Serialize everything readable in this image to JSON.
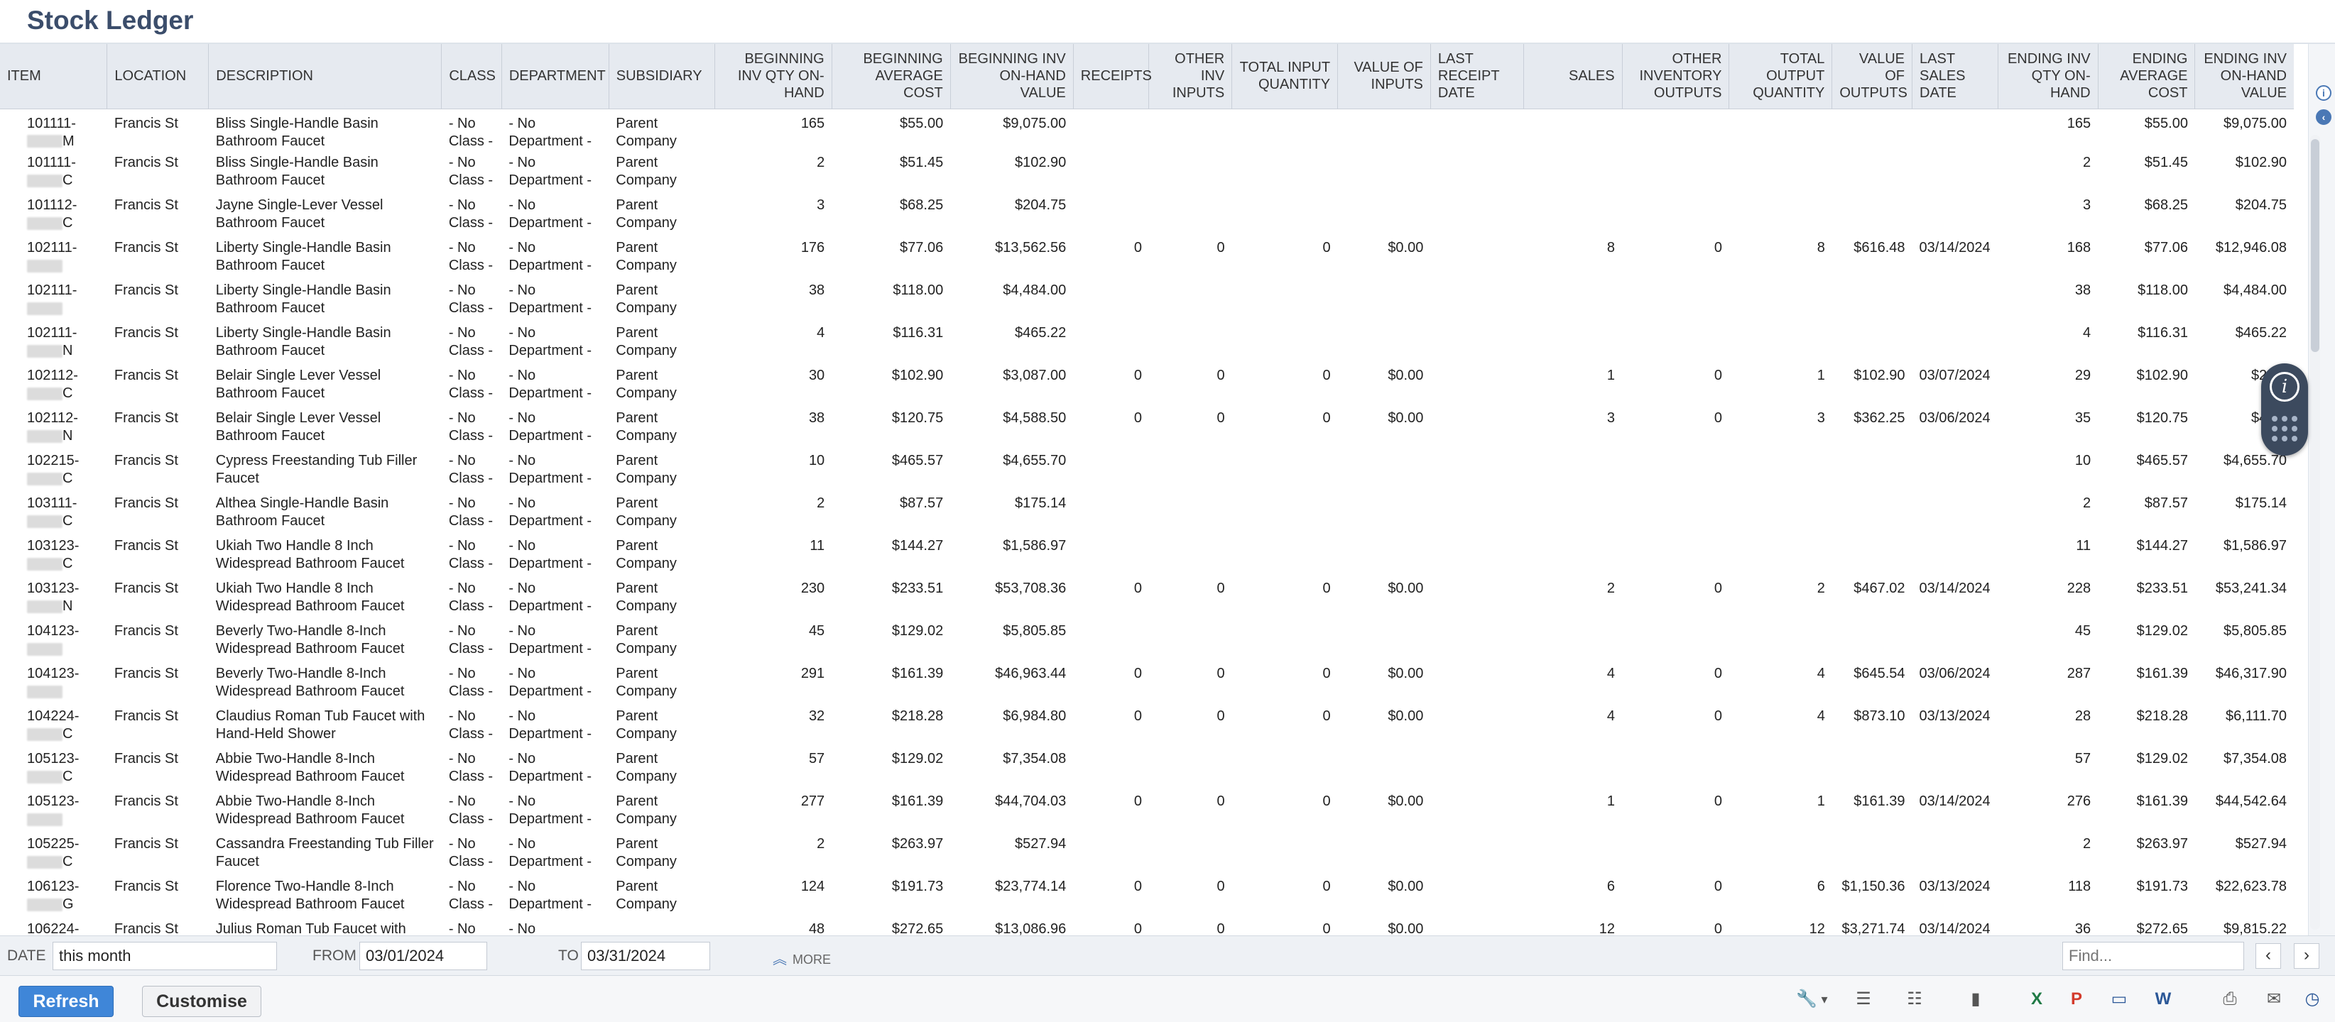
{
  "page": {
    "title": "Stock Ledger"
  },
  "table": {
    "headers": {
      "item": "ITEM",
      "location": "LOCATION",
      "description": "DESCRIPTION",
      "class": "CLASS",
      "department": "DEPARTMENT",
      "subsidiary": "SUBSIDIARY",
      "beg_qty": "BEGINNING INV QTY ON-HAND",
      "beg_avg": "BEGINNING AVERAGE COST",
      "beg_val": "BEGINNING INV ON-HAND VALUE",
      "receipts": "RECEIPTS",
      "other_inputs": "OTHER INV INPUTS",
      "total_input": "TOTAL INPUT QUANTITY",
      "value_inputs": "VALUE OF INPUTS",
      "last_receipt": "LAST RECEIPT DATE",
      "sales": "SALES",
      "other_outputs": "OTHER INVENTORY OUTPUTS",
      "total_output": "TOTAL OUTPUT QUANTITY",
      "value_outputs": "VALUE OF OUTPUTS",
      "last_sales": "LAST SALES DATE",
      "end_qty": "ENDING INV QTY ON-HAND",
      "end_avg": "ENDING AVERAGE COST",
      "end_val": "ENDING INV ON-HAND VALUE"
    },
    "rows": [
      {
        "item": "101111-",
        "item2": "M",
        "location": "Francis St",
        "description": "Bliss Single-Handle Basin Bathroom Faucet",
        "class": "- No Class -",
        "department": "- No Department -",
        "subsidiary": "Parent Company",
        "beg_qty": "165",
        "beg_avg": "$55.00",
        "beg_val": "$9,075.00",
        "receipts": "",
        "other_inputs": "",
        "total_input": "",
        "value_inputs": "",
        "last_receipt": "",
        "sales": "",
        "other_outputs": "",
        "total_output": "",
        "value_outputs": "",
        "last_sales": "",
        "end_qty": "165",
        "end_avg": "$55.00",
        "end_val": "$9,075.00"
      },
      {
        "item": "101111-",
        "item2": "C",
        "location": "Francis St",
        "description": "Bliss Single-Handle Basin Bathroom Faucet",
        "class": "- No Class -",
        "department": "- No Department -",
        "subsidiary": "Parent Company",
        "beg_qty": "2",
        "beg_avg": "$51.45",
        "beg_val": "$102.90",
        "receipts": "",
        "other_inputs": "",
        "total_input": "",
        "value_inputs": "",
        "last_receipt": "",
        "sales": "",
        "other_outputs": "",
        "total_output": "",
        "value_outputs": "",
        "last_sales": "",
        "end_qty": "2",
        "end_avg": "$51.45",
        "end_val": "$102.90"
      },
      {
        "item": "101112-",
        "item2": "C",
        "location": "Francis St",
        "description": "Jayne Single-Lever Vessel Bathroom Faucet",
        "class": "- No Class -",
        "department": "- No Department -",
        "subsidiary": "Parent Company",
        "beg_qty": "3",
        "beg_avg": "$68.25",
        "beg_val": "$204.75",
        "receipts": "",
        "other_inputs": "",
        "total_input": "",
        "value_inputs": "",
        "last_receipt": "",
        "sales": "",
        "other_outputs": "",
        "total_output": "",
        "value_outputs": "",
        "last_sales": "",
        "end_qty": "3",
        "end_avg": "$68.25",
        "end_val": "$204.75"
      },
      {
        "item": "102111-",
        "item2": "",
        "location": "Francis St",
        "description": "Liberty Single-Handle Basin Bathroom Faucet",
        "class": "- No Class -",
        "department": "- No Department -",
        "subsidiary": "Parent Company",
        "beg_qty": "176",
        "beg_avg": "$77.06",
        "beg_val": "$13,562.56",
        "receipts": "0",
        "other_inputs": "0",
        "total_input": "0",
        "value_inputs": "$0.00",
        "last_receipt": "",
        "sales": "8",
        "other_outputs": "0",
        "total_output": "8",
        "value_outputs": "$616.48",
        "last_sales": "03/14/2024",
        "end_qty": "168",
        "end_avg": "$77.06",
        "end_val": "$12,946.08"
      },
      {
        "item": "102111-",
        "item2": "",
        "location": "Francis St",
        "description": "Liberty Single-Handle Basin Bathroom Faucet",
        "class": "- No Class -",
        "department": "- No Department -",
        "subsidiary": "Parent Company",
        "beg_qty": "38",
        "beg_avg": "$118.00",
        "beg_val": "$4,484.00",
        "receipts": "",
        "other_inputs": "",
        "total_input": "",
        "value_inputs": "",
        "last_receipt": "",
        "sales": "",
        "other_outputs": "",
        "total_output": "",
        "value_outputs": "",
        "last_sales": "",
        "end_qty": "38",
        "end_avg": "$118.00",
        "end_val": "$4,484.00"
      },
      {
        "item": "102111-",
        "item2": "N",
        "location": "Francis St",
        "description": "Liberty Single-Handle Basin Bathroom Faucet",
        "class": "- No Class -",
        "department": "- No Department -",
        "subsidiary": "Parent Company",
        "beg_qty": "4",
        "beg_avg": "$116.31",
        "beg_val": "$465.22",
        "receipts": "",
        "other_inputs": "",
        "total_input": "",
        "value_inputs": "",
        "last_receipt": "",
        "sales": "",
        "other_outputs": "",
        "total_output": "",
        "value_outputs": "",
        "last_sales": "",
        "end_qty": "4",
        "end_avg": "$116.31",
        "end_val": "$465.22"
      },
      {
        "item": "102112-",
        "item2": "C",
        "location": "Francis St",
        "description": "Belair Single Lever Vessel Bathroom Faucet",
        "class": "- No Class -",
        "department": "- No Department -",
        "subsidiary": "Parent Company",
        "beg_qty": "30",
        "beg_avg": "$102.90",
        "beg_val": "$3,087.00",
        "receipts": "0",
        "other_inputs": "0",
        "total_input": "0",
        "value_inputs": "$0.00",
        "last_receipt": "",
        "sales": "1",
        "other_outputs": "0",
        "total_output": "1",
        "value_outputs": "$102.90",
        "last_sales": "03/07/2024",
        "end_qty": "29",
        "end_avg": "$102.90",
        "end_val": "$2,98"
      },
      {
        "item": "102112-",
        "item2": "N",
        "location": "Francis St",
        "description": "Belair Single Lever Vessel Bathroom Faucet",
        "class": "- No Class -",
        "department": "- No Department -",
        "subsidiary": "Parent Company",
        "beg_qty": "38",
        "beg_avg": "$120.75",
        "beg_val": "$4,588.50",
        "receipts": "0",
        "other_inputs": "0",
        "total_input": "0",
        "value_inputs": "$0.00",
        "last_receipt": "",
        "sales": "3",
        "other_outputs": "0",
        "total_output": "3",
        "value_outputs": "$362.25",
        "last_sales": "03/06/2024",
        "end_qty": "35",
        "end_avg": "$120.75",
        "end_val": "$4,22"
      },
      {
        "item": "102215-",
        "item2": "C",
        "location": "Francis St",
        "description": "Cypress Freestanding Tub Filler Faucet",
        "class": "- No Class -",
        "department": "- No Department -",
        "subsidiary": "Parent Company",
        "beg_qty": "10",
        "beg_avg": "$465.57",
        "beg_val": "$4,655.70",
        "receipts": "",
        "other_inputs": "",
        "total_input": "",
        "value_inputs": "",
        "last_receipt": "",
        "sales": "",
        "other_outputs": "",
        "total_output": "",
        "value_outputs": "",
        "last_sales": "",
        "end_qty": "10",
        "end_avg": "$465.57",
        "end_val": "$4,655.70"
      },
      {
        "item": "103111-",
        "item2": "C",
        "location": "Francis St",
        "description": "Althea Single-Handle Basin Bathroom Faucet",
        "class": "- No Class -",
        "department": "- No Department -",
        "subsidiary": "Parent Company",
        "beg_qty": "2",
        "beg_avg": "$87.57",
        "beg_val": "$175.14",
        "receipts": "",
        "other_inputs": "",
        "total_input": "",
        "value_inputs": "",
        "last_receipt": "",
        "sales": "",
        "other_outputs": "",
        "total_output": "",
        "value_outputs": "",
        "last_sales": "",
        "end_qty": "2",
        "end_avg": "$87.57",
        "end_val": "$175.14"
      },
      {
        "item": "103123-",
        "item2": "C",
        "location": "Francis St",
        "description": "Ukiah Two Handle 8 Inch Widespread Bathroom Faucet",
        "class": "- No Class -",
        "department": "- No Department -",
        "subsidiary": "Parent Company",
        "beg_qty": "11",
        "beg_avg": "$144.27",
        "beg_val": "$1,586.97",
        "receipts": "",
        "other_inputs": "",
        "total_input": "",
        "value_inputs": "",
        "last_receipt": "",
        "sales": "",
        "other_outputs": "",
        "total_output": "",
        "value_outputs": "",
        "last_sales": "",
        "end_qty": "11",
        "end_avg": "$144.27",
        "end_val": "$1,586.97"
      },
      {
        "item": "103123-",
        "item2": "N",
        "location": "Francis St",
        "description": "Ukiah Two Handle 8 Inch Widespread Bathroom Faucet",
        "class": "- No Class -",
        "department": "- No Department -",
        "subsidiary": "Parent Company",
        "beg_qty": "230",
        "beg_avg": "$233.51",
        "beg_val": "$53,708.36",
        "receipts": "0",
        "other_inputs": "0",
        "total_input": "0",
        "value_inputs": "$0.00",
        "last_receipt": "",
        "sales": "2",
        "other_outputs": "0",
        "total_output": "2",
        "value_outputs": "$467.02",
        "last_sales": "03/14/2024",
        "end_qty": "228",
        "end_avg": "$233.51",
        "end_val": "$53,241.34"
      },
      {
        "item": "104123-",
        "item2": "",
        "location": "Francis St",
        "description": "Beverly Two-Handle 8-Inch Widespread Bathroom Faucet",
        "class": "- No Class -",
        "department": "- No Department -",
        "subsidiary": "Parent Company",
        "beg_qty": "45",
        "beg_avg": "$129.02",
        "beg_val": "$5,805.85",
        "receipts": "",
        "other_inputs": "",
        "total_input": "",
        "value_inputs": "",
        "last_receipt": "",
        "sales": "",
        "other_outputs": "",
        "total_output": "",
        "value_outputs": "",
        "last_sales": "",
        "end_qty": "45",
        "end_avg": "$129.02",
        "end_val": "$5,805.85"
      },
      {
        "item": "104123-",
        "item2": "",
        "location": "Francis St",
        "description": "Beverly Two-Handle 8-Inch Widespread Bathroom Faucet",
        "class": "- No Class -",
        "department": "- No Department -",
        "subsidiary": "Parent Company",
        "beg_qty": "291",
        "beg_avg": "$161.39",
        "beg_val": "$46,963.44",
        "receipts": "0",
        "other_inputs": "0",
        "total_input": "0",
        "value_inputs": "$0.00",
        "last_receipt": "",
        "sales": "4",
        "other_outputs": "0",
        "total_output": "4",
        "value_outputs": "$645.54",
        "last_sales": "03/06/2024",
        "end_qty": "287",
        "end_avg": "$161.39",
        "end_val": "$46,317.90"
      },
      {
        "item": "104224-",
        "item2": "C",
        "location": "Francis St",
        "description": "Claudius Roman Tub Faucet with Hand-Held Shower",
        "class": "- No Class -",
        "department": "- No Department -",
        "subsidiary": "Parent Company",
        "beg_qty": "32",
        "beg_avg": "$218.28",
        "beg_val": "$6,984.80",
        "receipts": "0",
        "other_inputs": "0",
        "total_input": "0",
        "value_inputs": "$0.00",
        "last_receipt": "",
        "sales": "4",
        "other_outputs": "0",
        "total_output": "4",
        "value_outputs": "$873.10",
        "last_sales": "03/13/2024",
        "end_qty": "28",
        "end_avg": "$218.28",
        "end_val": "$6,111.70"
      },
      {
        "item": "105123-",
        "item2": "C",
        "location": "Francis St",
        "description": "Abbie Two-Handle 8-Inch Widespread Bathroom Faucet",
        "class": "- No Class -",
        "department": "- No Department -",
        "subsidiary": "Parent Company",
        "beg_qty": "57",
        "beg_avg": "$129.02",
        "beg_val": "$7,354.08",
        "receipts": "",
        "other_inputs": "",
        "total_input": "",
        "value_inputs": "",
        "last_receipt": "",
        "sales": "",
        "other_outputs": "",
        "total_output": "",
        "value_outputs": "",
        "last_sales": "",
        "end_qty": "57",
        "end_avg": "$129.02",
        "end_val": "$7,354.08"
      },
      {
        "item": "105123-",
        "item2": "",
        "location": "Francis St",
        "description": "Abbie Two-Handle 8-Inch Widespread Bathroom Faucet",
        "class": "- No Class -",
        "department": "- No Department -",
        "subsidiary": "Parent Company",
        "beg_qty": "277",
        "beg_avg": "$161.39",
        "beg_val": "$44,704.03",
        "receipts": "0",
        "other_inputs": "0",
        "total_input": "0",
        "value_inputs": "$0.00",
        "last_receipt": "",
        "sales": "1",
        "other_outputs": "0",
        "total_output": "1",
        "value_outputs": "$161.39",
        "last_sales": "03/14/2024",
        "end_qty": "276",
        "end_avg": "$161.39",
        "end_val": "$44,542.64"
      },
      {
        "item": "105225-",
        "item2": "C",
        "location": "Francis St",
        "description": "Cassandra Freestanding Tub Filler Faucet",
        "class": "- No Class -",
        "department": "- No Department -",
        "subsidiary": "Parent Company",
        "beg_qty": "2",
        "beg_avg": "$263.97",
        "beg_val": "$527.94",
        "receipts": "",
        "other_inputs": "",
        "total_input": "",
        "value_inputs": "",
        "last_receipt": "",
        "sales": "",
        "other_outputs": "",
        "total_output": "",
        "value_outputs": "",
        "last_sales": "",
        "end_qty": "2",
        "end_avg": "$263.97",
        "end_val": "$527.94"
      },
      {
        "item": "106123-",
        "item2": "G",
        "location": "Francis St",
        "description": "Florence Two-Handle 8-Inch Widespread Bathroom Faucet",
        "class": "- No Class -",
        "department": "- No Department -",
        "subsidiary": "Parent Company",
        "beg_qty": "124",
        "beg_avg": "$191.73",
        "beg_val": "$23,774.14",
        "receipts": "0",
        "other_inputs": "0",
        "total_input": "0",
        "value_inputs": "$0.00",
        "last_receipt": "",
        "sales": "6",
        "other_outputs": "0",
        "total_output": "6",
        "value_outputs": "$1,150.36",
        "last_sales": "03/13/2024",
        "end_qty": "118",
        "end_avg": "$191.73",
        "end_val": "$22,623.78"
      },
      {
        "item": "106224-",
        "item2": "",
        "location": "Francis St",
        "description": "Julius Roman Tub Faucet with Hand-",
        "class": "- No",
        "department": "- No",
        "subsidiary": "",
        "beg_qty": "48",
        "beg_avg": "$272.65",
        "beg_val": "$13,086.96",
        "receipts": "0",
        "other_inputs": "0",
        "total_input": "0",
        "value_inputs": "$0.00",
        "last_receipt": "",
        "sales": "12",
        "other_outputs": "0",
        "total_output": "12",
        "value_outputs": "$3,271.74",
        "last_sales": "03/14/2024",
        "end_qty": "36",
        "end_avg": "$272.65",
        "end_val": "$9,815.22"
      }
    ]
  },
  "filters": {
    "date_label": "DATE",
    "date_value": "this month",
    "from_label": "FROM",
    "from_value": "03/01/2024",
    "to_label": "TO",
    "to_value": "03/31/2024",
    "more_label": "MORE",
    "find_placeholder": "Find...",
    "prev_glyph": "‹",
    "next_glyph": "›"
  },
  "actions": {
    "refresh_label": "Refresh",
    "customise_label": "Customise"
  },
  "icons": {
    "float_info": "i",
    "side_info": "i",
    "side_collapse": "‹",
    "wrench": "🔧",
    "dropdown": "▾",
    "sort_asc": "☰",
    "sort_desc": "☷",
    "chart": "▮",
    "excel": "X",
    "pdf": "P",
    "doc": "▭",
    "word": "W",
    "print": "⎙",
    "email": "✉",
    "schedule": "◷"
  },
  "colors": {
    "accent": "#3f86d8",
    "title": "#3b4d6b",
    "header_bg": "#e6eaf0",
    "excel": "#1f7a45",
    "pdf": "#d33b2c",
    "word": "#2b5797"
  }
}
